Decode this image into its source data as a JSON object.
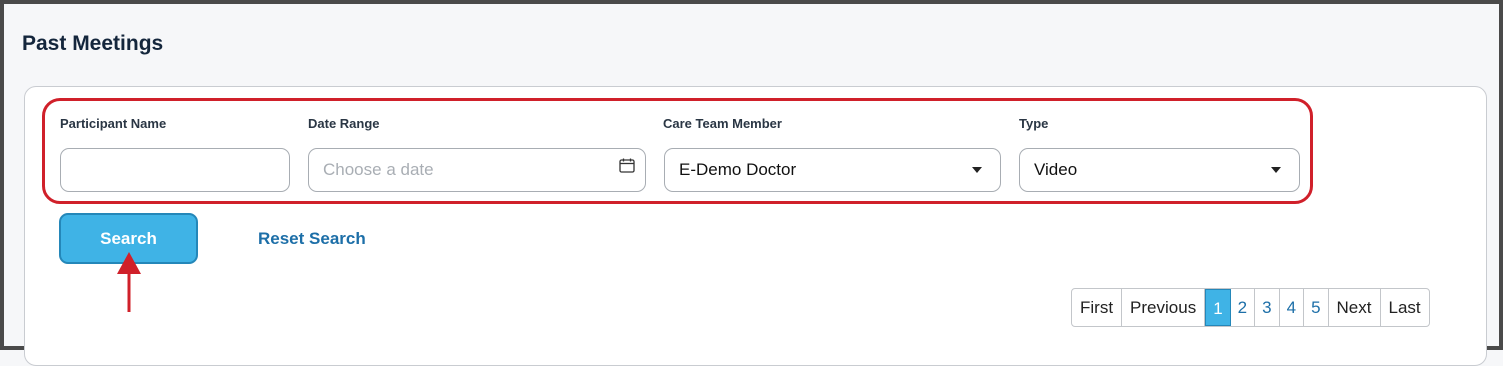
{
  "page": {
    "title": "Past Meetings"
  },
  "filters": {
    "participant_name": {
      "label": "Participant Name",
      "value": ""
    },
    "date_range": {
      "label": "Date Range",
      "placeholder": "Choose a date"
    },
    "care_team_member": {
      "label": "Care Team Member",
      "value": "E-Demo Doctor"
    },
    "type": {
      "label": "Type",
      "value": "Video"
    }
  },
  "actions": {
    "search_label": "Search",
    "reset_label": "Reset Search"
  },
  "pagination": {
    "first": "First",
    "previous": "Previous",
    "pages": [
      "1",
      "2",
      "3",
      "4",
      "5"
    ],
    "current_page": "1",
    "next": "Next",
    "last": "Last"
  },
  "colors": {
    "accent": "#3fb3e6",
    "highlight": "#d0202a",
    "link": "#1d6fa8"
  },
  "icons": [
    "calendar-icon",
    "chevron-down-icon",
    "red-arrow-annotation"
  ]
}
